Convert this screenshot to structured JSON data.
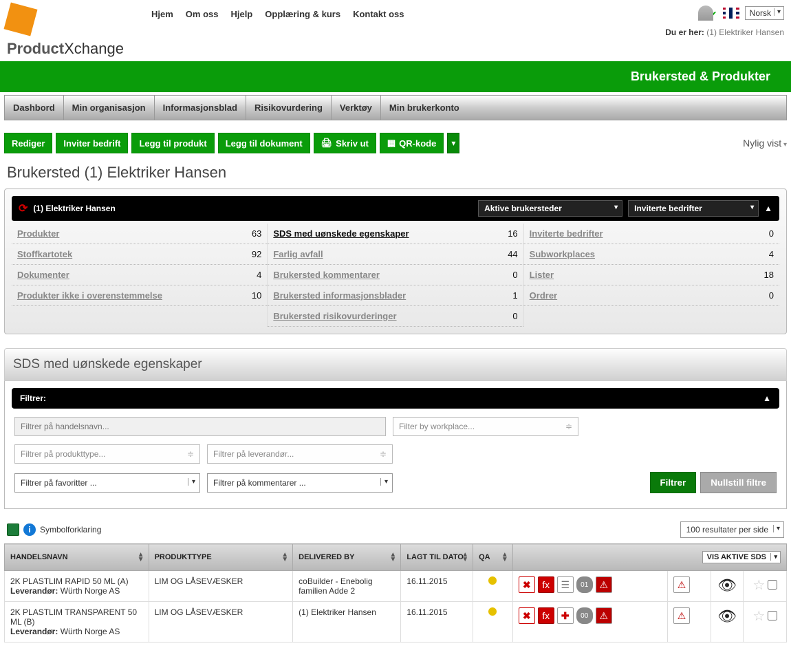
{
  "topnav": {
    "hjem": "Hjem",
    "omoss": "Om oss",
    "hjelp": "Hjelp",
    "opplaering": "Opplæring & kurs",
    "kontakt": "Kontakt oss"
  },
  "language": "Norsk",
  "breadcrumb_label": "Du er her:",
  "breadcrumb_value": "(1) Elektriker Hansen",
  "green_banner": "Brukersted & Produkter",
  "tabs": {
    "dashbord": "Dashbord",
    "minorg": "Min organisasjon",
    "infoblad": "Informasjonsblad",
    "risiko": "Risikovurdering",
    "verktoy": "Verktøy",
    "brukerkonto": "Min brukerkonto"
  },
  "actions": {
    "rediger": "Rediger",
    "inviter": "Inviter bedrift",
    "leggtilprodukt": "Legg til produkt",
    "leggtildok": "Legg til dokument",
    "skrivut": "Skriv ut",
    "qr": "QR-kode"
  },
  "nylig_vist": "Nylig vist",
  "page_title": "Brukersted (1) Elektriker Hansen",
  "summary": {
    "title": "(1) Elektriker Hansen",
    "dd1": "Aktive brukersteder",
    "dd2": "Inviterte bedrifter",
    "col1": [
      {
        "label": "Produkter",
        "value": "63"
      },
      {
        "label": "Stoffkartotek",
        "value": "92"
      },
      {
        "label": "Dokumenter",
        "value": "4"
      },
      {
        "label": "Produkter ikke i overenstemmelse",
        "value": "10"
      }
    ],
    "col2": [
      {
        "label": "SDS med uønskede egenskaper",
        "value": "16",
        "active": true
      },
      {
        "label": "Farlig avfall",
        "value": "44"
      },
      {
        "label": "Brukersted kommentarer",
        "value": "0"
      },
      {
        "label": "Brukersted informasjonsblader",
        "value": "1"
      },
      {
        "label": "Brukersted risikovurderinger",
        "value": "0"
      }
    ],
    "col3": [
      {
        "label": "Inviterte bedrifter",
        "value": "0"
      },
      {
        "label": "Subworkplaces",
        "value": "4"
      },
      {
        "label": "Lister",
        "value": "18"
      },
      {
        "label": "Ordrer",
        "value": "0"
      }
    ]
  },
  "section_title": "SDS med uønskede egenskaper",
  "filter": {
    "header": "Filtrer:",
    "tradename_ph": "Filtrer på handelsnavn...",
    "workplace_ph": "Filter by workplace...",
    "producttype_ph": "Filtrer på produkttype...",
    "supplier_ph": "Filtrer på leverandør...",
    "favorites_ph": "Filtrer på favoritter ...",
    "comments_ph": "Filtrer på kommentarer ...",
    "btn_filter": "Filtrer",
    "btn_reset": "Nullstill filtre"
  },
  "legend": "Symbolforklaring",
  "results_per_page": "100 resultater per side",
  "table": {
    "headers": {
      "handelsnavn": "HANDELSNAVN",
      "produkttype": "PRODUKTTYPE",
      "deliveredby": "DELIVERED BY",
      "lagttildato": "LAGT TIL DATO",
      "qa": "QA",
      "vis_active": "VIS AKTIVE SDS"
    },
    "rows": [
      {
        "name": "2K PLASTLIM RAPID 50 ML (A)",
        "supplier_lbl": "Leverandør:",
        "supplier": "Würth Norge AS",
        "ptype": "LIM OG LÅSEVÆSKER",
        "delivered": "coBuilder - Enebolig familien Adde 2",
        "date": "16.11.2015",
        "badge": "01"
      },
      {
        "name": "2K PLASTLIM TRANSPARENT 50 ML (B)",
        "supplier_lbl": "Leverandør:",
        "supplier": "Würth Norge AS",
        "ptype": "LIM OG LÅSEVÆSKER",
        "delivered": "(1) Elektriker Hansen",
        "date": "16.11.2015",
        "badge": "00"
      }
    ]
  }
}
